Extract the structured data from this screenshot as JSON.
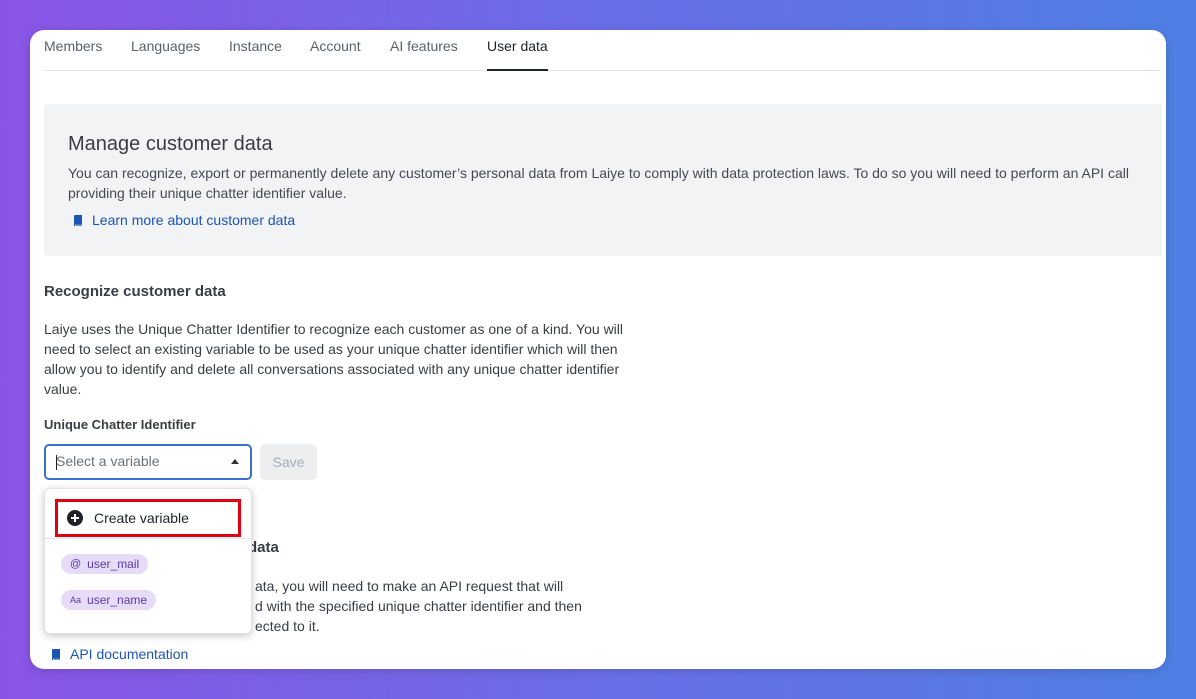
{
  "tabs": [
    {
      "label": "Members"
    },
    {
      "label": "Languages"
    },
    {
      "label": "Instance"
    },
    {
      "label": "Account"
    },
    {
      "label": "AI features"
    },
    {
      "label": "User data",
      "active": true
    }
  ],
  "banner": {
    "title": "Manage customer data",
    "description": "You can recognize, export or permanently delete any customer’s personal data from Laiye to comply with data protection laws. To do so you will need to perform an API call providing their unique chatter identifier value.",
    "link": "Learn more about customer data"
  },
  "recognize": {
    "title": "Recognize customer data",
    "description": "Laiye uses the Unique Chatter Identifier to recognize each customer as one of a kind. You will need to select an existing variable to be used as your unique chatter identifier which will then allow you to identify and delete all conversations associated with any unique chatter identifier value.",
    "field_label": "Unique Chatter Identifier",
    "select_placeholder": "Select a variable",
    "save_label": "Save"
  },
  "dropdown": {
    "create_label": "Create variable",
    "options": [
      {
        "icon": "@",
        "label": "user_mail"
      },
      {
        "icon": "Aa",
        "label": "user_name"
      }
    ]
  },
  "section2": {
    "title_fragment": "data",
    "lines": [
      "ata, you will need to make an API request that will",
      "d with the specified unique chatter identifier and then",
      "ected to it."
    ],
    "link": "API documentation"
  },
  "colors": {
    "accent": "#3a6fd0",
    "link": "#1d55b5",
    "highlight": "#e0000f",
    "chip_bg": "#e6dcf8"
  }
}
